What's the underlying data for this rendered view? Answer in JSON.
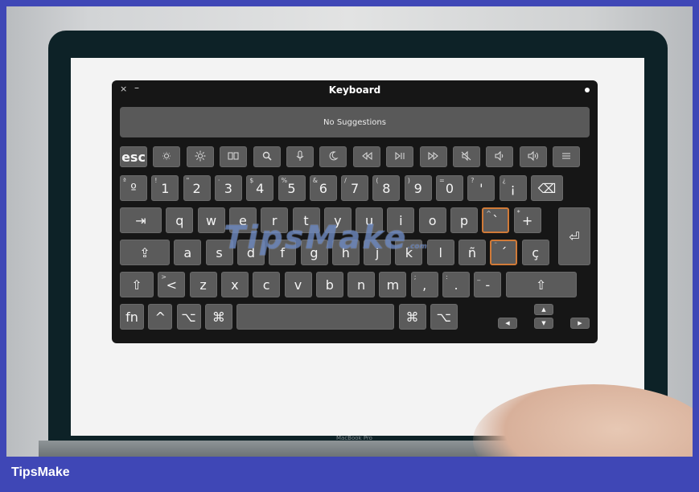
{
  "window": {
    "title": "Keyboard",
    "close": "×",
    "minimize": "–"
  },
  "suggestions": {
    "text": "No Suggestions"
  },
  "rows": {
    "fn": [
      {
        "label": "esc",
        "icon": ""
      },
      {
        "label": "",
        "icon": "brightness-down-icon"
      },
      {
        "label": "",
        "icon": "brightness-up-icon"
      },
      {
        "label": "",
        "icon": "mission-control-icon"
      },
      {
        "label": "",
        "icon": "search-icon"
      },
      {
        "label": "",
        "icon": "microphone-icon"
      },
      {
        "label": "",
        "icon": "moon-icon"
      },
      {
        "label": "",
        "icon": "rewind-icon"
      },
      {
        "label": "",
        "icon": "play-pause-icon"
      },
      {
        "label": "",
        "icon": "fast-forward-icon"
      },
      {
        "label": "",
        "icon": "mute-icon"
      },
      {
        "label": "",
        "icon": "volume-down-icon"
      },
      {
        "label": "",
        "icon": "volume-up-icon"
      },
      {
        "label": "",
        "icon": "list-icon"
      }
    ],
    "numbers": [
      {
        "main": "º",
        "shift": "ª"
      },
      {
        "main": "1",
        "shift": "!"
      },
      {
        "main": "2",
        "shift": "\""
      },
      {
        "main": "3",
        "shift": "·"
      },
      {
        "main": "4",
        "shift": "$"
      },
      {
        "main": "5",
        "shift": "%"
      },
      {
        "main": "6",
        "shift": "&"
      },
      {
        "main": "7",
        "shift": "/"
      },
      {
        "main": "8",
        "shift": "("
      },
      {
        "main": "9",
        "shift": ")"
      },
      {
        "main": "0",
        "shift": "="
      },
      {
        "main": "'",
        "shift": "?"
      },
      {
        "main": "¡",
        "shift": "¿"
      },
      {
        "main": "⌫",
        "shift": ""
      }
    ],
    "qwerty": [
      {
        "main": "⇥",
        "shift": ""
      },
      {
        "main": "q",
        "shift": ""
      },
      {
        "main": "w",
        "shift": ""
      },
      {
        "main": "e",
        "shift": ""
      },
      {
        "main": "r",
        "shift": ""
      },
      {
        "main": "t",
        "shift": ""
      },
      {
        "main": "y",
        "shift": ""
      },
      {
        "main": "u",
        "shift": ""
      },
      {
        "main": "i",
        "shift": ""
      },
      {
        "main": "o",
        "shift": ""
      },
      {
        "main": "p",
        "shift": ""
      },
      {
        "main": "`",
        "shift": "^"
      },
      {
        "main": "+",
        "shift": "*"
      }
    ],
    "home": [
      {
        "main": "⇪",
        "shift": ""
      },
      {
        "main": "a",
        "shift": ""
      },
      {
        "main": "s",
        "shift": ""
      },
      {
        "main": "d",
        "shift": ""
      },
      {
        "main": "f",
        "shift": ""
      },
      {
        "main": "g",
        "shift": ""
      },
      {
        "main": "h",
        "shift": ""
      },
      {
        "main": "j",
        "shift": ""
      },
      {
        "main": "k",
        "shift": ""
      },
      {
        "main": "l",
        "shift": ""
      },
      {
        "main": "ñ",
        "shift": ""
      },
      {
        "main": "´",
        "shift": "¨"
      },
      {
        "main": "ç",
        "shift": ""
      }
    ],
    "bottom": [
      {
        "main": "⇧",
        "shift": ""
      },
      {
        "main": "<",
        "shift": ">"
      },
      {
        "main": "z",
        "shift": ""
      },
      {
        "main": "x",
        "shift": ""
      },
      {
        "main": "c",
        "shift": ""
      },
      {
        "main": "v",
        "shift": ""
      },
      {
        "main": "b",
        "shift": ""
      },
      {
        "main": "n",
        "shift": ""
      },
      {
        "main": "m",
        "shift": ""
      },
      {
        "main": ",",
        "shift": ";"
      },
      {
        "main": ".",
        "shift": ":"
      },
      {
        "main": "-",
        "shift": "_"
      },
      {
        "main": "⇧",
        "shift": ""
      }
    ],
    "modifiers": [
      {
        "main": "fn"
      },
      {
        "main": "^"
      },
      {
        "main": "⌥"
      },
      {
        "main": "⌘"
      },
      {
        "main": ""
      },
      {
        "main": "⌘"
      },
      {
        "main": "⌥"
      }
    ],
    "return_key": "⏎",
    "arrows": {
      "up": "▲",
      "left": "◀",
      "down": "▼",
      "right": "▶"
    }
  },
  "watermark": {
    "text": "TipsMake",
    "sub": ".com"
  },
  "photo": {
    "laptop_label": "MacBook Pro"
  },
  "footer": {
    "brand": "TipsMake"
  },
  "colors": {
    "frame": "#3f47b6",
    "key": "#5b5b5b",
    "highlight": "#d07a38",
    "window": "#161616"
  }
}
